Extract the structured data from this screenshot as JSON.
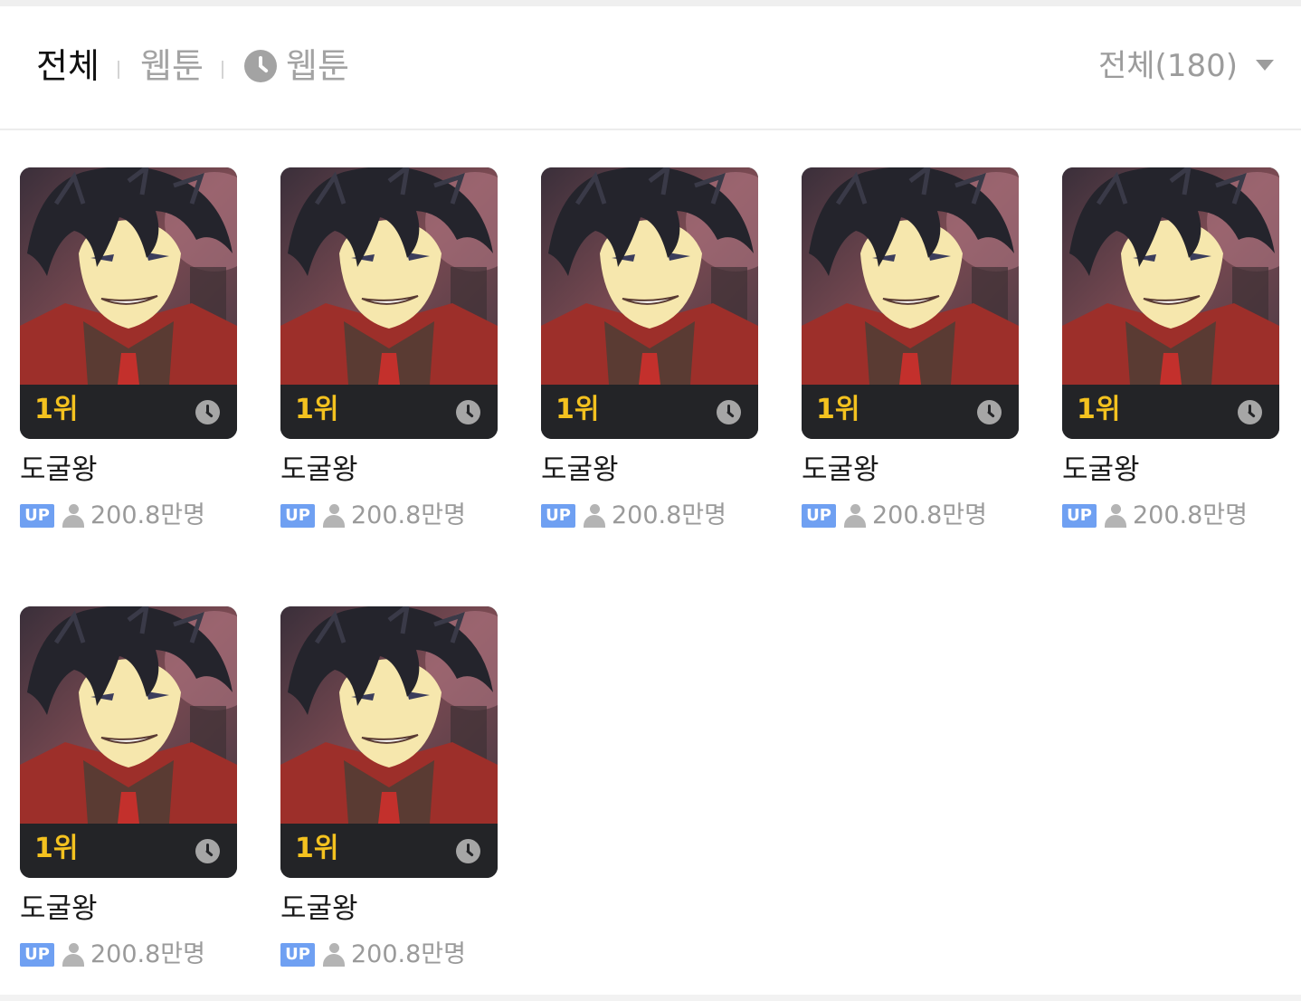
{
  "tabs": [
    {
      "label": "전체",
      "active": true
    },
    {
      "label": "웹툰",
      "active": false
    },
    {
      "label": "웹툰",
      "active": false,
      "icon": "clock-icon"
    }
  ],
  "sort": {
    "label": "전체(180)",
    "icon": "caret-down-icon"
  },
  "cards": [
    {
      "rank": "1위",
      "title": "도굴왕",
      "badge": "UP",
      "viewers": "200.8만명",
      "status_icon": "clock-icon"
    },
    {
      "rank": "1위",
      "title": "도굴왕",
      "badge": "UP",
      "viewers": "200.8만명",
      "status_icon": "clock-icon"
    },
    {
      "rank": "1위",
      "title": "도굴왕",
      "badge": "UP",
      "viewers": "200.8만명",
      "status_icon": "clock-icon"
    },
    {
      "rank": "1위",
      "title": "도굴왕",
      "badge": "UP",
      "viewers": "200.8만명",
      "status_icon": "clock-icon"
    },
    {
      "rank": "1위",
      "title": "도굴왕",
      "badge": "UP",
      "viewers": "200.8만명",
      "status_icon": "clock-icon"
    },
    {
      "rank": "1위",
      "title": "도굴왕",
      "badge": "UP",
      "viewers": "200.8만명",
      "status_icon": "clock-icon"
    },
    {
      "rank": "1위",
      "title": "도굴왕",
      "badge": "UP",
      "viewers": "200.8만명",
      "status_icon": "clock-icon"
    }
  ],
  "colors": {
    "rank": "#f4c21f",
    "up_badge": "#6fa0f2",
    "rank_bar": "#232427"
  }
}
